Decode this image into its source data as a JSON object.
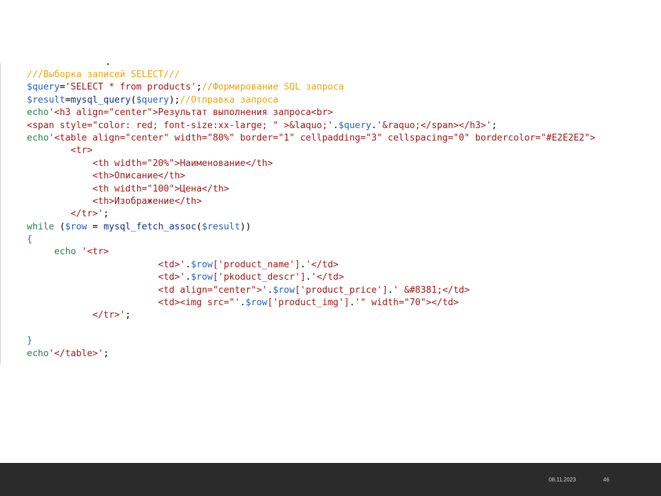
{
  "code": {
    "lines": [
      [
        {
          "t": "///Выборка записей SELECT///",
          "c": "c"
        }
      ],
      [
        {
          "t": "$query",
          "c": "v"
        },
        {
          "t": "=",
          "c": "p"
        },
        {
          "t": "'SELECT * from products'",
          "c": "s"
        },
        {
          "t": ";",
          "c": "p"
        },
        {
          "t": "//Формирование SQL запроса",
          "c": "c"
        }
      ],
      [
        {
          "t": "$result",
          "c": "v"
        },
        {
          "t": "=",
          "c": "p"
        },
        {
          "t": "mysql_query",
          "c": "f"
        },
        {
          "t": "(",
          "c": "p"
        },
        {
          "t": "$query",
          "c": "v"
        },
        {
          "t": ");",
          "c": "p"
        },
        {
          "t": "//Отправка запроса",
          "c": "c"
        }
      ],
      [
        {
          "t": "echo",
          "c": "k"
        },
        {
          "t": "'<h3 align=\"center\">Результат выполнения запроса<br>",
          "c": "s"
        }
      ],
      [
        {
          "t": "<span style=\"color: red; font-size:xx-large; \" >&laquo;'",
          "c": "s"
        },
        {
          "t": ".",
          "c": "p"
        },
        {
          "t": "$query",
          "c": "v"
        },
        {
          "t": ".",
          "c": "p"
        },
        {
          "t": "'&raquo;</span></h3>'",
          "c": "s"
        },
        {
          "t": ";",
          "c": "p"
        }
      ],
      [
        {
          "t": "echo",
          "c": "k"
        },
        {
          "t": "'<table align=\"center\" width=\"80%\" border=\"1\" cellpadding=\"3\" cellspacing=\"0\" bordercolor=\"#E2E2E2\">",
          "c": "s"
        }
      ],
      [
        {
          "t": "        <tr>",
          "c": "s"
        }
      ],
      [
        {
          "t": "            <th width=\"20%\">Наименование</th>",
          "c": "s"
        }
      ],
      [
        {
          "t": "            <th>Описание</th>",
          "c": "s"
        }
      ],
      [
        {
          "t": "            <th width=\"100\">Цена</th>",
          "c": "s"
        }
      ],
      [
        {
          "t": "            <th>Изображение</th>",
          "c": "s"
        }
      ],
      [
        {
          "t": "        </tr>'",
          "c": "s"
        },
        {
          "t": ";",
          "c": "p"
        }
      ],
      [
        {
          "t": "while",
          "c": "k"
        },
        {
          "t": " (",
          "c": "p"
        },
        {
          "t": "$row",
          "c": "v"
        },
        {
          "t": " = ",
          "c": "p"
        },
        {
          "t": "mysql_fetch_assoc",
          "c": "f"
        },
        {
          "t": "(",
          "c": "p"
        },
        {
          "t": "$result",
          "c": "v"
        },
        {
          "t": "))",
          "c": "p"
        }
      ],
      [
        {
          "t": "{",
          "c": "v"
        }
      ],
      [
        {
          "t": "     echo ",
          "c": "k"
        },
        {
          "t": "'<tr>",
          "c": "s"
        }
      ],
      [
        {
          "t": "                        <td>'",
          "c": "s"
        },
        {
          "t": ".",
          "c": "p"
        },
        {
          "t": "$row",
          "c": "v"
        },
        {
          "t": "['product_name']",
          "c": "s"
        },
        {
          "t": ".",
          "c": "p"
        },
        {
          "t": "'</td>",
          "c": "s"
        }
      ],
      [
        {
          "t": "                        <td>'",
          "c": "s"
        },
        {
          "t": ".",
          "c": "p"
        },
        {
          "t": "$row",
          "c": "v"
        },
        {
          "t": "['pkoduct_descr']",
          "c": "s"
        },
        {
          "t": ".",
          "c": "p"
        },
        {
          "t": "'</td>",
          "c": "s"
        }
      ],
      [
        {
          "t": "                        <td align=\"center\">'",
          "c": "s"
        },
        {
          "t": ".",
          "c": "p"
        },
        {
          "t": "$row",
          "c": "v"
        },
        {
          "t": "['product_price']",
          "c": "s"
        },
        {
          "t": ".",
          "c": "p"
        },
        {
          "t": "' &#8381;</td>",
          "c": "s"
        }
      ],
      [
        {
          "t": "                        <td><img src=\"'",
          "c": "s"
        },
        {
          "t": ".",
          "c": "p"
        },
        {
          "t": "$row",
          "c": "v"
        },
        {
          "t": "['product_img']",
          "c": "s"
        },
        {
          "t": ".",
          "c": "p"
        },
        {
          "t": "'\" width=\"70\"></td>",
          "c": "s"
        }
      ],
      [
        {
          "t": "            </tr>'",
          "c": "s"
        },
        {
          "t": ";",
          "c": "p"
        }
      ],
      [
        {
          "t": "",
          "c": "p"
        }
      ],
      [
        {
          "t": "}",
          "c": "v"
        }
      ],
      [
        {
          "t": "echo",
          "c": "k"
        },
        {
          "t": "'</table>'",
          "c": "s"
        },
        {
          "t": ";",
          "c": "p"
        }
      ]
    ]
  },
  "footer": {
    "date": "08.11.2023",
    "page": "46"
  },
  "colors": {
    "comment": "#f0a30a",
    "string": "#a31515",
    "variable": "#1f5fbf",
    "function": "#0a2f8c",
    "keyword": "#2b7a4b",
    "footer_bg": "#2b2b2b"
  }
}
